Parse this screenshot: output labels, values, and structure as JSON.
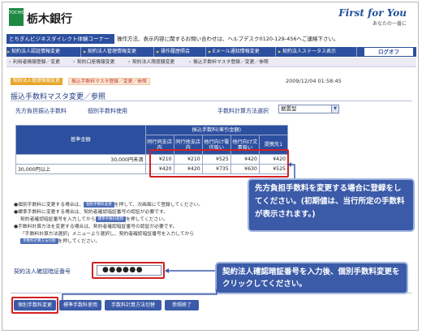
{
  "header": {
    "logo_text": "TOCHIGIN",
    "bank_name": "栃木銀行",
    "slogan": "First for You",
    "slogan_sub": "あなたの一番に"
  },
  "bar": {
    "corner_title": "とちぎんビジネスダイレクト体験コーナー",
    "info_text": "操作方法、表示内容に関するお問い合わせは、ヘルプデスク0120-129-456へご連絡下さい。"
  },
  "nav": {
    "items": [
      {
        "label": "契約法人認証情報変更"
      },
      {
        "label": "契約法人管理情報変更"
      },
      {
        "label": "操作履歴照会"
      },
      {
        "label": "Eメール通知情報変更"
      },
      {
        "label": "契約法人ステータス表示"
      }
    ],
    "logout_label": "ログオフ"
  },
  "subnav": {
    "items": [
      {
        "label": "利用者情報登録／変更"
      },
      {
        "label": "契約口座情報変更"
      },
      {
        "label": "契約法人限度額変更"
      },
      {
        "label": "振込手数料マスタ登録／変更／参照"
      }
    ]
  },
  "breadcrumb": {
    "first": "契約法人管理情報変更",
    "second": "振込手数料マスタ登録／変更／参照"
  },
  "timestamp": "2009/12/04  01:58:45",
  "page_title": "振込手数料マスタ変更／参照",
  "options": {
    "payer_label": "先方負担振込手数料",
    "individual_label": "個別手数料使用",
    "calc_label": "手数料計算方法選択",
    "calc_value": "据置型"
  },
  "table": {
    "base_header": "基準金額",
    "group_header": "振込手数料(差引金額)",
    "columns": [
      "同行同支店内",
      "同行他支店内",
      "他行向け電信扱い",
      "他行向け文書扱い",
      "提携先1"
    ],
    "rows": [
      {
        "base": "30,000円未満",
        "values": [
          "¥210",
          "¥210",
          "¥525",
          "¥420",
          "¥420"
        ]
      },
      {
        "base": "30,000円以上",
        "values": [
          "¥420",
          "¥420",
          "¥735",
          "¥630",
          "¥525"
        ]
      }
    ]
  },
  "notes": {
    "n1_a": "●個別手数料に変更する場合は、",
    "n1_btn": "個別手数料変更",
    "n1_b": "を押して、次画面にて登録してください。",
    "n2_a": "●標準手数料に変更する場合は、契約者確認暗証番号の認証が必要です。",
    "n2_b": "契約者確認暗証番号を入力してから",
    "n2_btn": "標準手数料使用",
    "n2_c": "を押してください。",
    "n3_a": "●手数料計算方法を変更する場合は、契約者確認暗証番号の認証が必要です。",
    "n3_b": "「手数料計算方法選択」メニューより選択し、契約者確認暗証番号を入力してから",
    "n3_btn": "手数料計算方法切替",
    "n3_c": "を押してください。"
  },
  "pin": {
    "label": "契約法人確認暗証番号",
    "value": "●●●●●●"
  },
  "callouts": {
    "first": "先方負担手数料を変更する場合に登録をしてください。(初期値は、当行所定の手数料が表示されます。)",
    "second": "契約法人確認暗証番号を入力後、個別手数料変更をクリックしてください。"
  },
  "buttons": {
    "individual": "個別手数料変更",
    "standard": "標準手数料使用",
    "calc_switch": "手数料計算方法切替",
    "end": "参照終了"
  },
  "colors": {
    "nav_blue": "#2c4f9f",
    "highlight_red": "#d32020",
    "callout_blue": "#3b5aa8",
    "logo_green": "#1d8a44"
  }
}
